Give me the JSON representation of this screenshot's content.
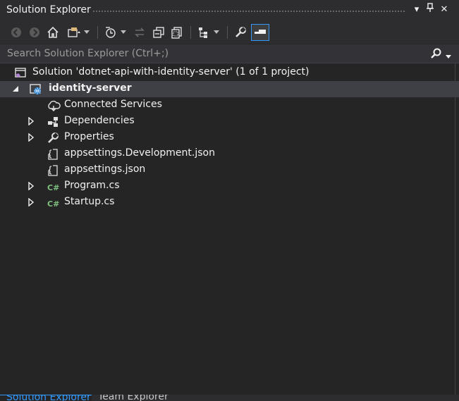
{
  "window": {
    "title": "Solution Explorer",
    "dropdown_icon": "▾",
    "pin_icon": "⊥",
    "close_icon": "✕"
  },
  "toolbar": {
    "buttons": [
      "back-icon",
      "forward-icon",
      "home-icon",
      "switch-views-icon",
      "pending-changes-filter-icon",
      "sync-icon",
      "collapse-all-icon",
      "show-all-files-icon",
      "tree-view-icon",
      "properties-icon",
      "preview-selected-items-icon"
    ]
  },
  "search": {
    "placeholder": "Search Solution Explorer (Ctrl+;)"
  },
  "tree": {
    "solution": "Solution 'dotnet-api-with-identity-server' (1 of 1 project)",
    "project": "identity-server",
    "items": [
      {
        "label": "Connected Services",
        "icon": "cloud-icon",
        "expandable": false
      },
      {
        "label": "Dependencies",
        "icon": "dependencies-icon",
        "expandable": true
      },
      {
        "label": "Properties",
        "icon": "wrench-icon",
        "expandable": true
      },
      {
        "label": "appsettings.Development.json",
        "icon": "json-file-icon",
        "expandable": false
      },
      {
        "label": "appsettings.json",
        "icon": "json-file-icon",
        "expandable": false
      },
      {
        "label": "Program.cs",
        "icon": "csharp-file-icon",
        "expandable": true
      },
      {
        "label": "Startup.cs",
        "icon": "csharp-file-icon",
        "expandable": true
      }
    ]
  },
  "bottom_tabs": [
    {
      "label": "Solution Explorer",
      "active": true
    },
    {
      "label": "Team Explorer",
      "active": false
    }
  ],
  "colors": {
    "accent": "#3399ff",
    "background": "#252526",
    "csharp_green": "#7ec07e",
    "solution_purple": "#b180d7"
  }
}
